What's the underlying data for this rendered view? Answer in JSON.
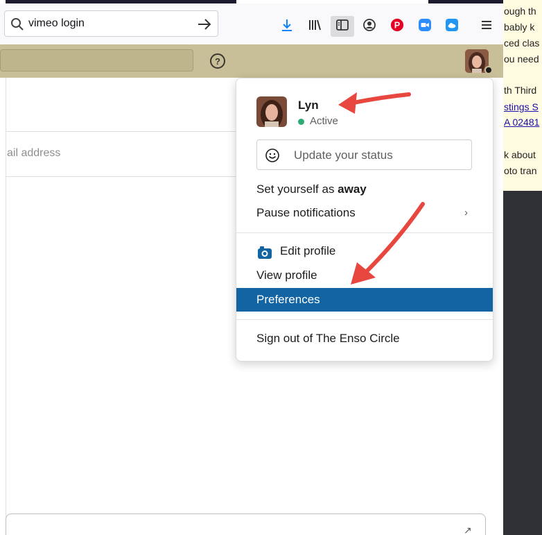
{
  "browser": {
    "url_text": "vimeo login"
  },
  "toolbar_icons": [
    "download-icon",
    "library-icon",
    "sidebar-icon",
    "account-icon",
    "pinterest-icon",
    "zoom-icon",
    "cloud-icon",
    "menu-icon"
  ],
  "workspace": {
    "help_label": "?"
  },
  "main": {
    "email_placeholder": "ail address",
    "expand_glyph": "↗"
  },
  "background_doc": {
    "lines": [
      "ough th",
      "bably k",
      "ced clas",
      "ou need",
      "th Third",
      "stings S",
      "A 02481",
      "k about",
      "oto tran"
    ]
  },
  "menu": {
    "user_name": "Lyn",
    "presence": "Active",
    "status_placeholder": "Update your status",
    "set_away_prefix": "Set yourself as ",
    "set_away_bold": "away",
    "pause_notifications": "Pause notifications",
    "edit_profile": "Edit profile",
    "view_profile": "View profile",
    "preferences": "Preferences",
    "sign_out": "Sign out of The Enso Circle"
  },
  "colors": {
    "workspace_header": "#c8bf98",
    "highlight": "#1264a3",
    "active_green": "#2bac76",
    "arrow_red": "#e8473f"
  }
}
